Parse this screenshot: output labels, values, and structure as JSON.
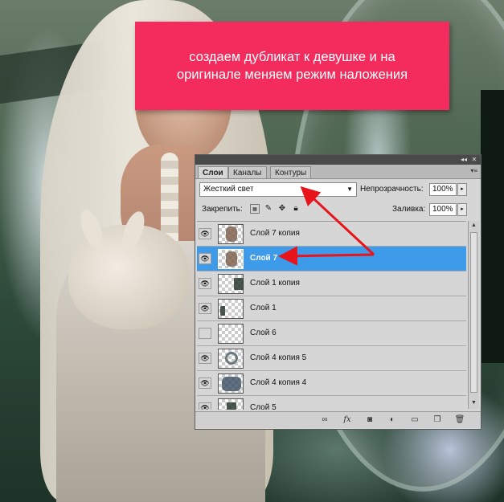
{
  "callout": {
    "line1": "создаем дубликат к девушке и на",
    "line2": "оригинале меняем режим наложения",
    "color": "#f32c5d"
  },
  "panel": {
    "tabs": [
      {
        "label": "Слои",
        "active": true
      },
      {
        "label": "Каналы",
        "active": false
      },
      {
        "label": "Контуры",
        "active": false
      }
    ],
    "blend_mode": "Жесткий свет",
    "opacity_label": "Непрозрачность:",
    "opacity_value": "100%",
    "lock_label": "Закрепить:",
    "fill_label": "Заливка:",
    "fill_value": "100%",
    "layers": [
      {
        "name": "Слой 7 копия",
        "visible": true,
        "selected": false,
        "thumb": "girl-icon"
      },
      {
        "name": "Слой 7",
        "visible": true,
        "selected": true,
        "thumb": "girl-icon"
      },
      {
        "name": "Слой 1 копия",
        "visible": true,
        "selected": false,
        "thumb": "rect-icon"
      },
      {
        "name": "Слой 1",
        "visible": true,
        "selected": false,
        "thumb": "edge-icon"
      },
      {
        "name": "Слой 6",
        "visible": false,
        "selected": false,
        "thumb": "empty"
      },
      {
        "name": "Слой 4 копия 5",
        "visible": true,
        "selected": false,
        "thumb": "ring-icon"
      },
      {
        "name": "Слой 4 копия 4",
        "visible": true,
        "selected": false,
        "thumb": "dark-icon"
      },
      {
        "name": "Слой 5",
        "visible": true,
        "selected": false,
        "thumb": "rect-icon"
      }
    ],
    "selected_color": "#3d9bea"
  },
  "annotation_color": "#e8141c"
}
